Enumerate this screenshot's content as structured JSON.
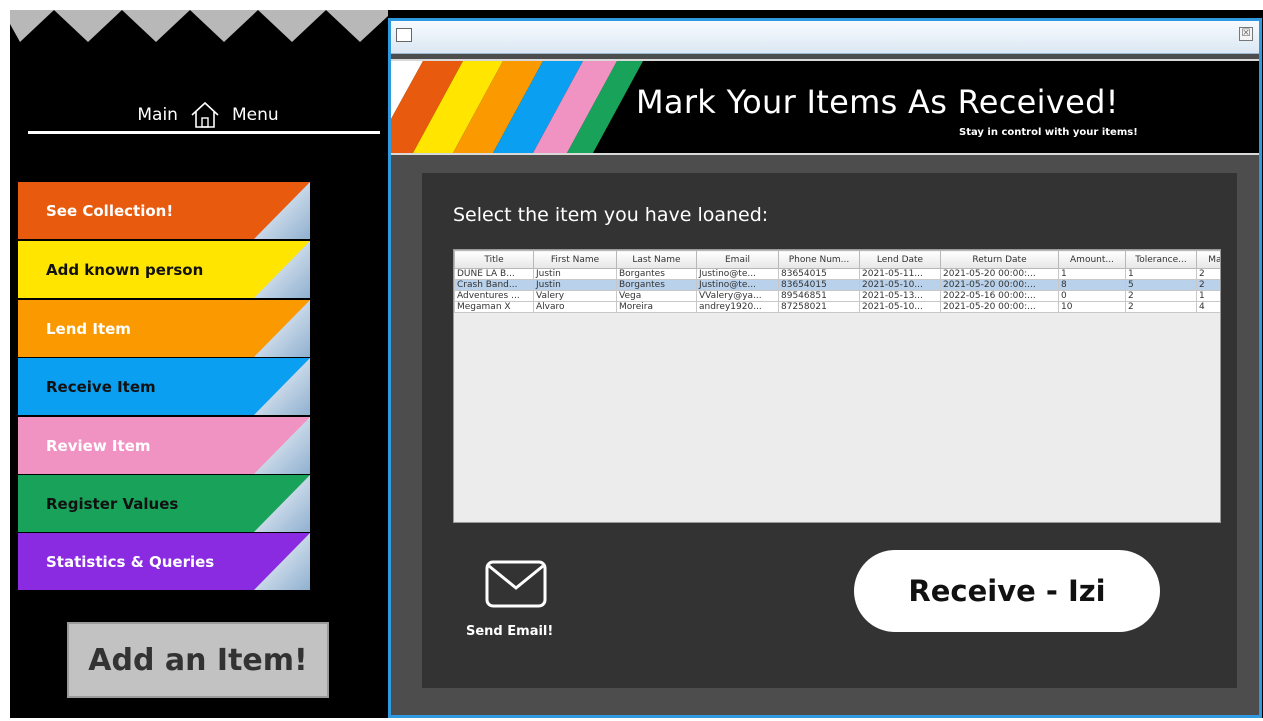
{
  "sidebar": {
    "main_menu_left": "Main",
    "main_menu_right": "Menu",
    "items": [
      {
        "label": "See Collection!",
        "bg": "#e85a0d",
        "fg": "#ffffff"
      },
      {
        "label": "Add known person",
        "bg": "#ffe500",
        "fg": "#111111"
      },
      {
        "label": "Lend Item",
        "bg": "#fa9a00",
        "fg": "#ffffff"
      },
      {
        "label": "Receive Item",
        "bg": "#0a9ff0",
        "fg": "#111111"
      },
      {
        "label": "Review Item",
        "bg": "#f093c2",
        "fg": "#ffffff"
      },
      {
        "label": "Register Values",
        "bg": "#19a35a",
        "fg": "#111111"
      },
      {
        "label": "Statistics & Queries",
        "bg": "#8a2be2",
        "fg": "#ffffff"
      }
    ],
    "add_item_label": "Add an Item!"
  },
  "window": {
    "close_glyph": "☒",
    "banner_title": "Mark Your Items As Received!",
    "banner_subtitle": "Stay in control with your items!",
    "select_label": "Select the item you have loaned:",
    "table": {
      "columns": [
        "Title",
        "First Name",
        "Last Name",
        "Email",
        "Phone Num...",
        "Lend Date",
        "Return Date",
        "Amount...",
        "Tolerance...",
        "Max Toler..."
      ],
      "rows": [
        [
          "DUNE LA B...",
          "Justin",
          "Borgantes",
          "Justino@te...",
          "83654015",
          "2021-05-11...",
          "2021-05-20 00:00:...",
          "1",
          "1",
          "2"
        ],
        [
          "Crash Band...",
          "Justin",
          "Borgantes",
          "Justino@te...",
          "83654015",
          "2021-05-10...",
          "2021-05-20 00:00:...",
          "8",
          "5",
          "2"
        ],
        [
          "Adventures ...",
          "Valery",
          "Vega",
          "VValery@ya...",
          "89546851",
          "2021-05-13...",
          "2022-05-16 00:00:...",
          "0",
          "2",
          "1"
        ],
        [
          "Megaman X",
          "Alvaro",
          "Moreira",
          "andrey1920...",
          "87258021",
          "2021-05-10...",
          "2021-05-20 00:00:...",
          "10",
          "2",
          "4"
        ]
      ],
      "selected_row": 1
    },
    "send_email_label": "Send Email!",
    "receive_button_label": "Receive - Izi"
  },
  "colors": {
    "accent_border": "#2f9ae0",
    "selected_row": "#b9d1ea",
    "panel_bg": "#333333"
  }
}
